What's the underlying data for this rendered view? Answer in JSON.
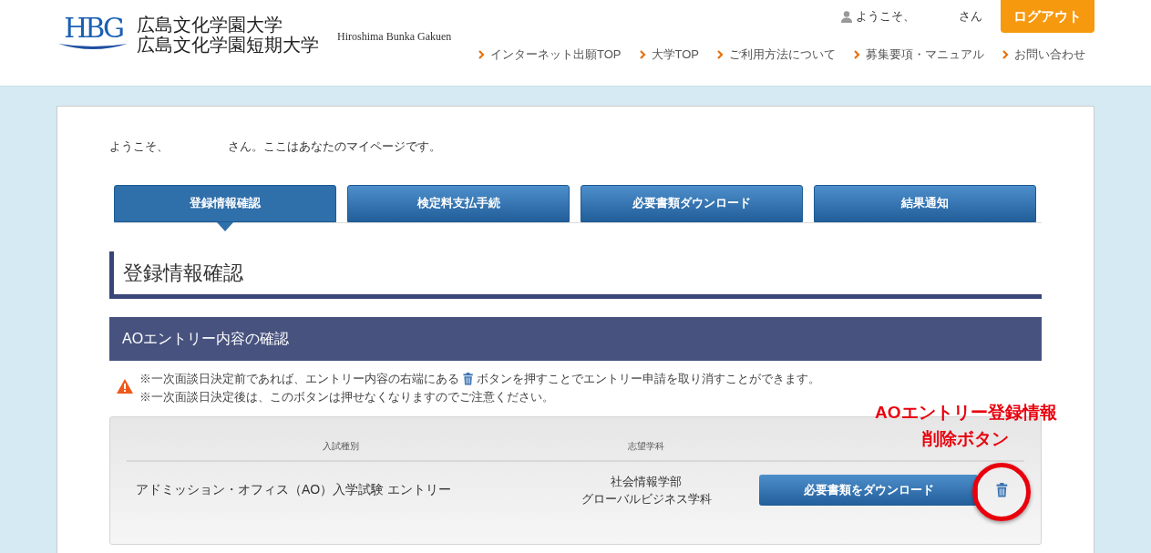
{
  "header": {
    "logo_letters": "HBG",
    "university_names": [
      "広島文化学園大学",
      "広島文化学園短期大学"
    ],
    "romaji": "Hiroshima Bunka Gakuen",
    "welcome": "ようこそ、",
    "honorific": "さん",
    "logout_button": "ログアウト",
    "nav": [
      "インターネット出願TOP",
      "大学TOP",
      "ご利用方法について",
      "募集要項・マニュアル",
      "お問い合わせ"
    ]
  },
  "greeting": "ようこそ、　　　　　さん。ここはあなたのマイページです。",
  "tabs": [
    {
      "label": "登録情報確認",
      "selected": true
    },
    {
      "label": "検定料支払手続",
      "selected": false
    },
    {
      "label": "必要書類ダウンロード",
      "selected": false
    },
    {
      "label": "結果通知",
      "selected": false
    }
  ],
  "page_title": "登録情報確認",
  "section_title": "AOエントリー内容の確認",
  "notice": {
    "line1_before": "※一次面談日決定前であれば、エントリー内容の右端にある",
    "line1_after": "ボタンを押すことでエントリー申請を取り消すことができます。",
    "line2": "※一次面談日決定後は、このボタンは押せなくなりますのでご注意ください。"
  },
  "table": {
    "columns": [
      "入試種別",
      "志望学科"
    ],
    "rows": [
      {
        "exam_type": "アドミッション・オフィス（AO）入学試験 エントリー",
        "department": [
          "社会情報学部",
          "グローバルビジネス学科"
        ],
        "download_button": "必要書類をダウンロード"
      }
    ]
  },
  "annotation": [
    "AOエントリー登録情報",
    "削除ボタン"
  ]
}
